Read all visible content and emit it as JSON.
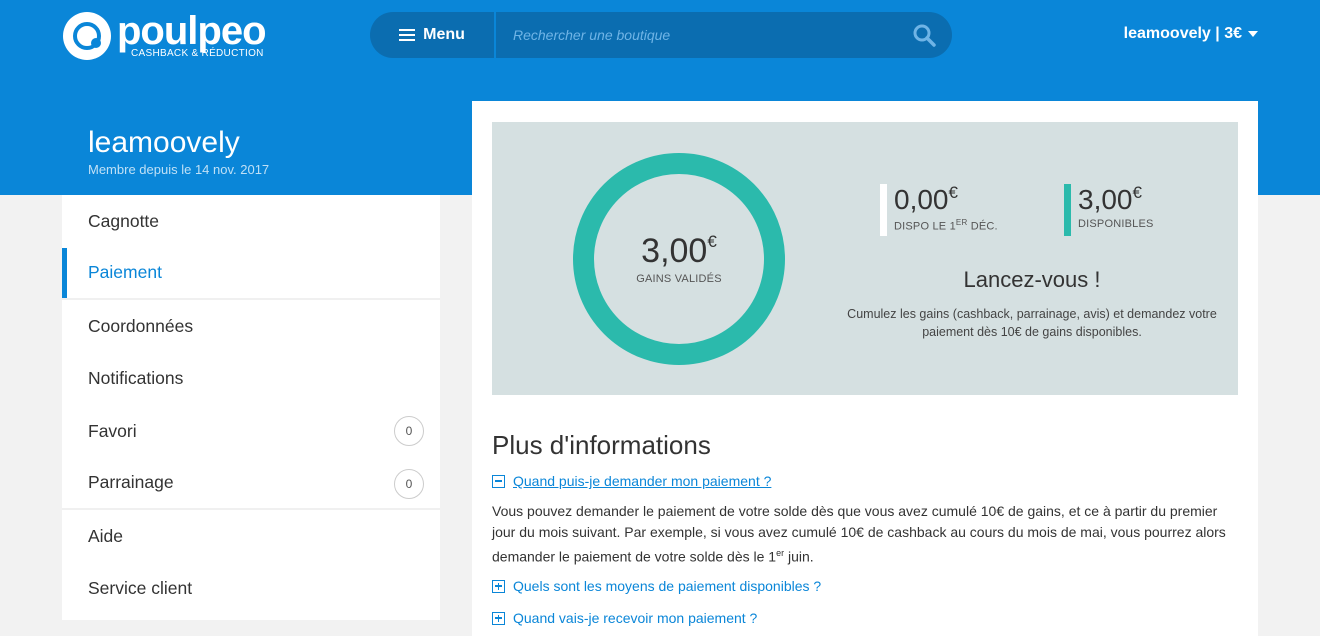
{
  "brand": {
    "name": "poulpeo",
    "tagline": "CASHBACK & RÉDUCTION"
  },
  "header": {
    "menu_label": "Menu",
    "search_placeholder": "Rechercher une boutique",
    "account_label": "leamoovely | 3€"
  },
  "profile": {
    "name": "leamoovely",
    "member_since": "Membre depuis le 14 nov. 2017"
  },
  "sidebar": {
    "items": [
      {
        "label": "Cagnotte"
      },
      {
        "label": "Paiement",
        "active": true
      },
      {
        "label": "Coordonnées"
      },
      {
        "label": "Notifications"
      },
      {
        "label": "Favori",
        "badge": "0"
      },
      {
        "label": "Parrainage",
        "badge": "0"
      },
      {
        "label": "Aide"
      },
      {
        "label": "Service client"
      }
    ]
  },
  "summary": {
    "validated_amount": "3,00",
    "currency": "€",
    "validated_label": "GAINS VALIDÉS",
    "pending_amount": "0,00",
    "pending_label_prefix": "DISPO LE 1",
    "pending_label_sup": "ER",
    "pending_label_suffix": "DÉC.",
    "available_amount": "3,00",
    "available_label": "DISPONIBLES",
    "launch_title": "Lancez-vous !",
    "launch_desc": "Cumulez les gains (cashback, parrainage, avis) et demandez votre paiement dès 10€ de gains disponibles."
  },
  "info": {
    "title": "Plus d'informations",
    "faq": [
      {
        "question": "Quand puis-je demander mon paiement ?",
        "open": true,
        "answer_main": "Vous pouvez demander le paiement de votre solde dès que vous avez cumulé 10€ de gains, et ce à partir du premier jour du mois suivant. Par exemple, si vous avez cumulé 10€ de cashback au cours du mois de mai, vous pourrez alors demander le paiement de votre solde dès le 1",
        "answer_sup": "er",
        "answer_end": " juin."
      },
      {
        "question": "Quels sont les moyens de paiement disponibles ?",
        "open": false
      },
      {
        "question": "Quand vais-je recevoir mon paiement ?",
        "open": false
      }
    ]
  },
  "colors": {
    "brand_blue": "#0a86d8",
    "search_bg": "#0b6db0",
    "teal": "#2bbaac",
    "summary_bg": "#d5e0e1"
  }
}
